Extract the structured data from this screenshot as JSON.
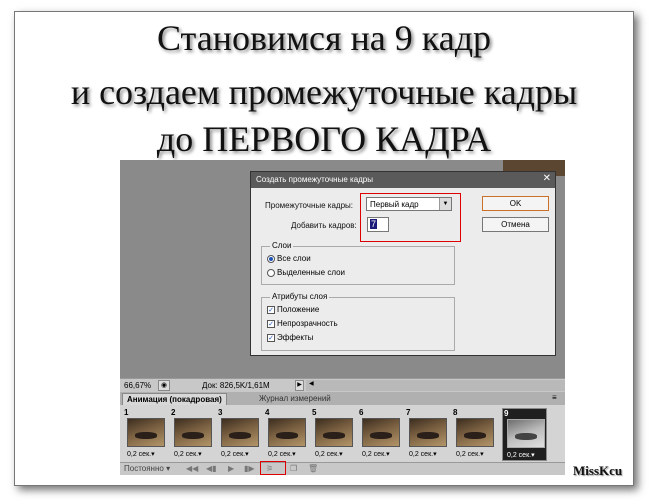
{
  "heading": {
    "line1": "Становимся на 9 кадр",
    "line2": "и создаем промежуточные кадры",
    "line3": "до ПЕРВОГО КАДРА"
  },
  "status": {
    "zoom": "66,67%",
    "doc": "Док: 826,5K/1,61M"
  },
  "panel": {
    "tab_animation": "Анимация (покадровая)",
    "tab_history": "Журнал измерений"
  },
  "frames": [
    {
      "number": "1",
      "duration": "0,2 сек."
    },
    {
      "number": "2",
      "duration": "0,2 сек."
    },
    {
      "number": "3",
      "duration": "0,2 сек."
    },
    {
      "number": "4",
      "duration": "0,2 сек."
    },
    {
      "number": "5",
      "duration": "0,2 сек."
    },
    {
      "number": "6",
      "duration": "0,2 сек."
    },
    {
      "number": "7",
      "duration": "0,2 сек."
    },
    {
      "number": "8",
      "duration": "0,2 сек."
    },
    {
      "number": "9",
      "duration": "0,2 сек.",
      "selected": true
    }
  ],
  "controls": {
    "loop": "Постоянно"
  },
  "dialog": {
    "title": "Создать промежуточные кадры",
    "tween_with_label": "Промежуточные кадры:",
    "tween_with_value": "Первый кадр",
    "frames_to_add_label": "Добавить кадров:",
    "frames_to_add_value": "7",
    "ok": "OK",
    "cancel": "Отмена",
    "layers_group": "Слои",
    "all_layers": "Все слои",
    "selected_layers": "Выделенные слои",
    "params_group": "Атрибуты слоя",
    "position": "Положение",
    "opacity": "Непрозрачность",
    "effects": "Эффекты"
  },
  "signature": "MissKcu",
  "colors": {
    "highlight": "#dd0000",
    "dialog_title_bar": "#5a5a5a",
    "workspace": "#8a8a8a"
  }
}
